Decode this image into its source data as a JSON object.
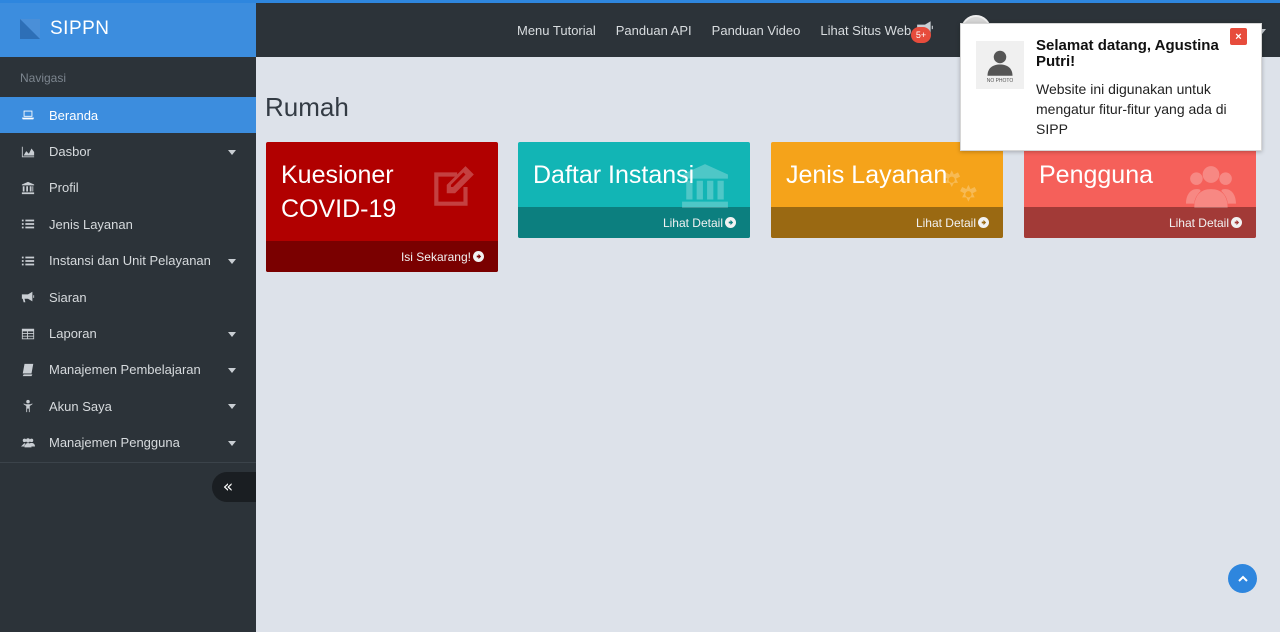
{
  "brand": {
    "name": "SIPPN"
  },
  "sidebar": {
    "header": "Navigasi",
    "items": [
      {
        "label": "Beranda",
        "icon": "laptop-icon",
        "active": true,
        "has_submenu": false
      },
      {
        "label": "Dasbor",
        "icon": "area-chart-icon",
        "active": false,
        "has_submenu": true
      },
      {
        "label": "Profil",
        "icon": "institution-icon",
        "active": false,
        "has_submenu": false
      },
      {
        "label": "Jenis Layanan",
        "icon": "list-icon",
        "active": false,
        "has_submenu": false
      },
      {
        "label": "Instansi dan Unit Pelayanan",
        "icon": "list-icon",
        "active": false,
        "has_submenu": true
      },
      {
        "label": "Siaran",
        "icon": "bullhorn-icon",
        "active": false,
        "has_submenu": false
      },
      {
        "label": "Laporan",
        "icon": "table-icon",
        "active": false,
        "has_submenu": true
      },
      {
        "label": "Manajemen Pembelajaran",
        "icon": "book-icon",
        "active": false,
        "has_submenu": true
      },
      {
        "label": "Akun Saya",
        "icon": "user-icon",
        "active": false,
        "has_submenu": true
      },
      {
        "label": "Manajemen Pengguna",
        "icon": "users-icon",
        "active": false,
        "has_submenu": true
      }
    ],
    "collapse_label": "«"
  },
  "topbar": {
    "links": [
      "Menu Tutorial",
      "Panduan API",
      "Panduan Video",
      "Lihat Situs Web"
    ],
    "notification_badge": "5+"
  },
  "page": {
    "title": "Rumah"
  },
  "cards": [
    {
      "title": "Kuesioner COVID-19",
      "footer": "Isi Sekarang!",
      "icon": "edit-icon",
      "color": "#b10000",
      "footer_color": "#7a0000"
    },
    {
      "title": "Daftar Instansi",
      "footer": "Lihat Detail",
      "icon": "institution-icon",
      "color": "#12b5b5",
      "footer_color": "#0c7f7f"
    },
    {
      "title": "Jenis Layanan",
      "footer": "Lihat Detail",
      "icon": "gears-icon",
      "color": "#f5a31a",
      "footer_color": "#9a6912"
    },
    {
      "title": "Pengguna",
      "footer": "Lihat Detail",
      "icon": "users-icon",
      "color": "#f5605a",
      "footer_color": "#a23a37"
    }
  ],
  "notification": {
    "title": "Selamat datang, Agustina Putri!",
    "message": "Website ini digunakan untuk mengatur fitur-fitur yang ada di SIPP",
    "photo_label": "NO PHOTO",
    "close_label": "×"
  },
  "colors": {
    "primary": "#3c8dde",
    "sidebar": "#2c3339",
    "background": "#dde2ea"
  }
}
